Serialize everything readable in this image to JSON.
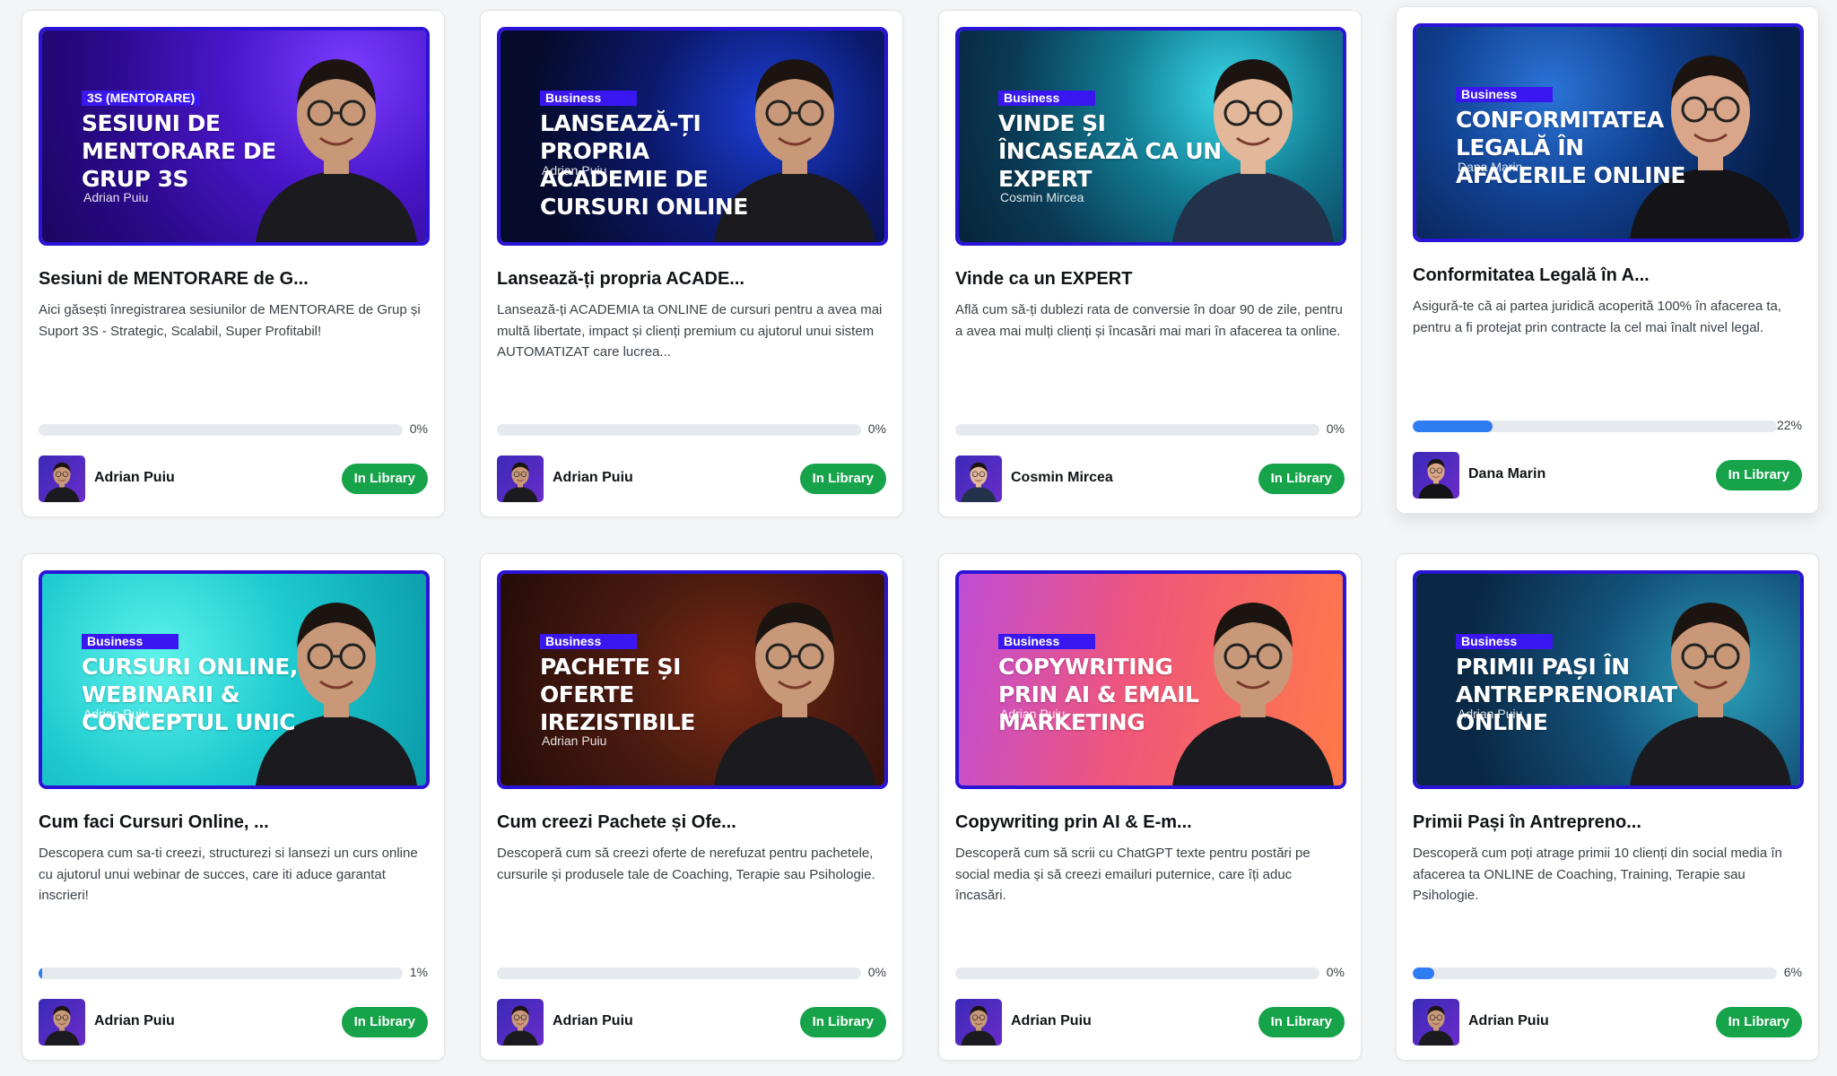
{
  "button_label": "In Library",
  "colors": {
    "accent": "#16a34a",
    "progress": "#2f7bf2",
    "thumb_border": "#2a14d6"
  },
  "cards": [
    {
      "thumb_tag": "3S (MENTORARE)",
      "thumb_headline": "SESIUNI DE MENTORARE DE GRUP 3S",
      "thumb_byline": "Adrian Puiu",
      "title": "Sesiuni de MENTORARE de G...",
      "description": "Aici găsești înregistrarea sesiunilor de MENTORARE de Grup și Suport 3S - Strategic, Scalabil, Super Profitabil!",
      "progress_percent": 0,
      "progress_label": "0%",
      "author": "Adrian Puiu",
      "theme": "purple"
    },
    {
      "thumb_tag": "Business",
      "thumb_headline": "LANSEAZĂ-ȚI PROPRIA ACADEMIE DE CURSURI ONLINE",
      "thumb_byline": "Adrian Puiu",
      "title": "Lansează-ți propria ACADE...",
      "description": "Lansează-ți ACADEMIA ta ONLINE de cursuri pentru a avea mai multă libertate, impact și clienți premium cu ajutorul unui sistem AUTOMATIZAT care lucrea...",
      "progress_percent": 0,
      "progress_label": "0%",
      "author": "Adrian Puiu",
      "theme": "navy"
    },
    {
      "thumb_tag": "Business",
      "thumb_headline": "VINDE ȘI ÎNCASEAZĂ CA UN EXPERT",
      "thumb_byline": "Cosmin Mircea",
      "title": "Vinde ca un EXPERT",
      "description": "Află cum să-ți dublezi rata de conversie în doar 90 de zile, pentru a avea mai mulți clienți și încasări mai mari în afacerea ta online.",
      "progress_percent": 0,
      "progress_label": "0%",
      "author": "Cosmin Mircea",
      "theme": "teal"
    },
    {
      "thumb_tag": "Business",
      "thumb_headline": "CONFORMITATEA LEGALĂ ÎN AFACERILE ONLINE",
      "thumb_byline": "Dana Marin",
      "title": "Conformitatea Legală în A...",
      "description": "Asigură-te că ai partea juridică acoperită 100% în afacerea ta, pentru a fi protejat prin contracte la cel mai înalt nivel legal.",
      "progress_percent": 22,
      "progress_label": "22%",
      "author": "Dana Marin",
      "theme": "deepblue"
    },
    {
      "thumb_tag": "Business",
      "thumb_headline": "CURSURI ONLINE, WEBINARII & CONCEPTUL UNIC",
      "thumb_byline": "Adrian Puiu",
      "title": "Cum faci Cursuri Online, ...",
      "description": "Descopera cum sa-ti creezi, structurezi si lansezi un curs online cu ajutorul unui webinar de succes, care iti aduce garantat inscrieri!",
      "progress_percent": 1,
      "progress_label": "1%",
      "author": "Adrian Puiu",
      "theme": "cyan"
    },
    {
      "thumb_tag": "Business",
      "thumb_headline": "PACHETE ȘI OFERTE IREZISTIBILE",
      "thumb_byline": "Adrian Puiu",
      "title": "Cum creezi Pachete și Ofe...",
      "description": "Descoperă cum să creezi oferte de nerefuzat pentru pachetele, cursurile și produsele tale de Coaching, Terapie sau Psihologie.",
      "progress_percent": 0,
      "progress_label": "0%",
      "author": "Adrian Puiu",
      "theme": "brown"
    },
    {
      "thumb_tag": "Business",
      "thumb_headline": "COPYWRITING PRIN AI & EMAIL MARKETING",
      "thumb_byline": "Adrian Puiu",
      "title": "Copywriting prin AI & E-m...",
      "description": "Descoperă cum să scrii cu ChatGPT texte pentru postări pe social media și să creezi emailuri puternice, care îți aduc încasări.",
      "progress_percent": 0,
      "progress_label": "0%",
      "author": "Adrian Puiu",
      "theme": "sunset"
    },
    {
      "thumb_tag": "Business",
      "thumb_headline": "PRIMII PAȘI ÎN ANTREPRENORIAT ONLINE",
      "thumb_byline": "Adrian Puiu",
      "title": "Primii Pași în Antrepreno...",
      "description": "Descoperă cum poți atrage primii 10 clienți din social media în afacerea ta ONLINE de Coaching, Training, Terapie sau Psihologie.",
      "progress_percent": 6,
      "progress_label": "6%",
      "author": "Adrian Puiu",
      "theme": "ocean"
    }
  ]
}
